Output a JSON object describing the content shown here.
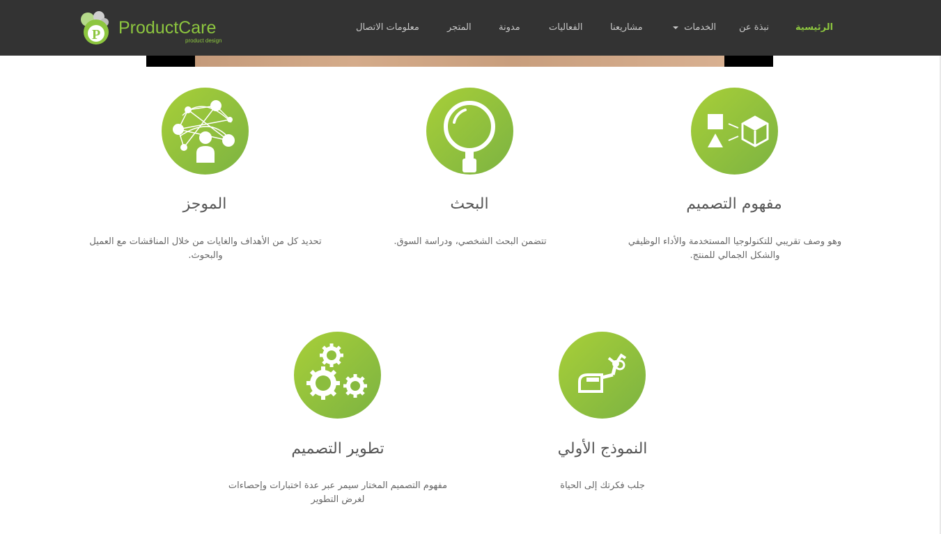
{
  "brand": {
    "name": "ProductCare",
    "tagline": "product design",
    "accent": "#8dc63f"
  },
  "nav": {
    "items": [
      {
        "label": "الرئيسية",
        "active": true
      },
      {
        "label": "نبذة عن"
      },
      {
        "label": "الخدمات",
        "dropdown": true
      },
      {
        "label": "مشاريعنا"
      },
      {
        "label": "الفعاليات"
      },
      {
        "label": "مدونة"
      },
      {
        "label": "المتجر"
      },
      {
        "label": "معلومات الاتصال"
      }
    ]
  },
  "features": [
    {
      "icon": "shapes-cube-icon",
      "title": "مفهوم التصميم",
      "desc": "وهو وصف تقريبي للتكنولوجيا المستخدمة والأداء الوظيفي والشكل الجمالي للمنتج."
    },
    {
      "icon": "magnifier-icon",
      "title": "البحث",
      "desc": "تتضمن البحث الشخصي، ودراسة السوق."
    },
    {
      "icon": "network-person-icon",
      "title": "الموجز",
      "desc": "تحديد كل من الأهداف والغايات من خلال المناقشات مع العميل والبحوث."
    },
    {
      "icon": "robot-arm-icon",
      "title": "النموذج الأولي",
      "desc": "جلب فكرتك إلى الحياة"
    },
    {
      "icon": "gears-icon",
      "title": "تطوير التصميم",
      "desc": "مفهوم التصميم المختار سيمر عبر عدة اختبارات وإحصاءات لغرض التطوير"
    }
  ]
}
